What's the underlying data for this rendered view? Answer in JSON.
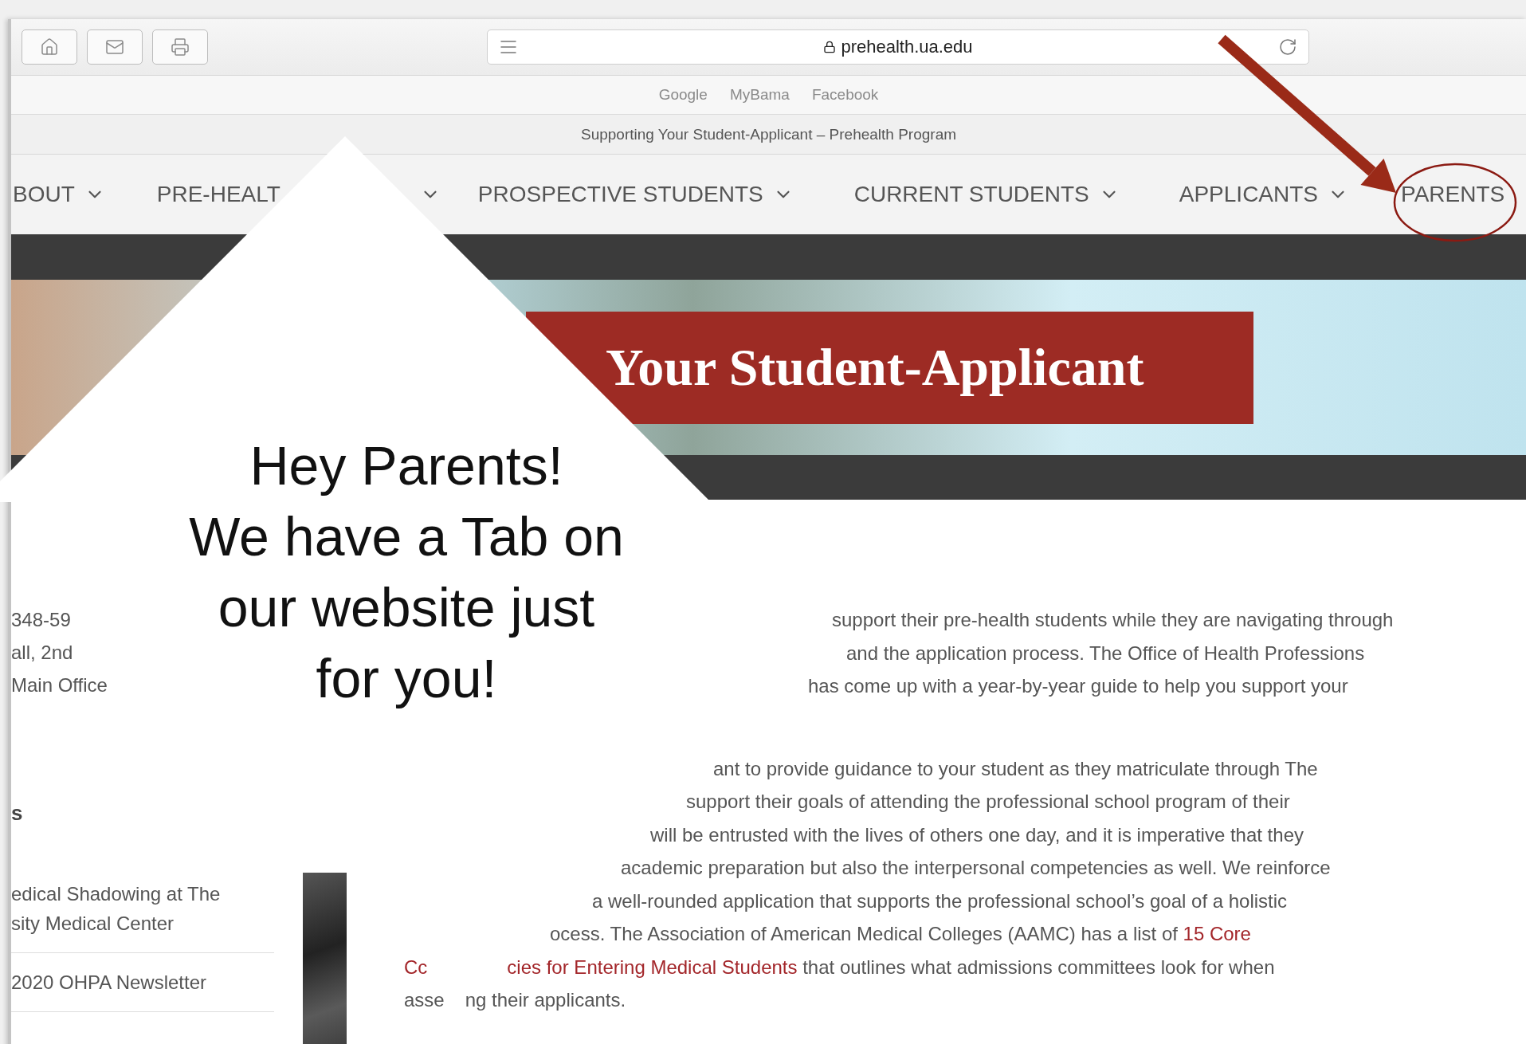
{
  "browser": {
    "buttons": [
      {
        "kind": "home"
      },
      {
        "kind": "mail"
      },
      {
        "kind": "print"
      }
    ],
    "address": "prehealth.ua.edu"
  },
  "bookmarks": [
    "Google",
    "MyBama",
    "Facebook"
  ],
  "page_title": "Supporting Your Student-Applicant – Prehealth Program",
  "nav": [
    {
      "label": "BOUT",
      "dropdown": true
    },
    {
      "label": "PRE-HEALT",
      "dropdown": true
    },
    {
      "label": "PROSPECTIVE STUDENTS",
      "dropdown": true
    },
    {
      "label": "CURRENT STUDENTS",
      "dropdown": true
    },
    {
      "label": "APPLICANTS",
      "dropdown": true
    },
    {
      "label": "PARENTS",
      "dropdown": false
    }
  ],
  "banner": {
    "title": "Your Student-Applicant"
  },
  "sidebar": {
    "contact": [
      "348-59",
      "all, 2nd",
      "Main Office"
    ],
    "heading": "s",
    "links": [
      {
        "lines": [
          "edical Shadowing at The",
          "sity Medical Center"
        ]
      },
      {
        "lines": [
          "2020 OHPA Newsletter"
        ]
      }
    ]
  },
  "body": [
    {
      "lines": [
        {
          "pieces": [
            {
              "runs": [
                {
                  "text": "support their pre-health students while they are navigating through",
                  "link": false
                }
              ]
            }
          ]
        },
        {
          "pieces": [
            {
              "runs": [
                {
                  "text": "and the application process. The Office of Health Professions",
                  "link": false
                }
              ]
            }
          ]
        },
        {
          "pieces": [
            {
              "runs": [
                {
                  "text": "has come up with a year-by-year guide to help you support your",
                  "link": false
                }
              ]
            }
          ]
        }
      ]
    },
    {
      "lines": [
        {
          "pieces": [
            {
              "runs": [
                {
                  "text": "ant to provide guidance to your student as they matriculate through The",
                  "link": false
                }
              ]
            }
          ]
        },
        {
          "pieces": [
            {
              "runs": [
                {
                  "text": "support their goals of attending the professional school program of their",
                  "link": false
                }
              ]
            }
          ]
        },
        {
          "pieces": [
            {
              "runs": [
                {
                  "text": "will be entrusted with the lives of others one day, and it is imperative that they",
                  "link": false
                }
              ]
            }
          ]
        },
        {
          "pieces": [
            {
              "runs": [
                {
                  "text": "academic preparation but also the interpersonal competencies as well. We reinforce",
                  "link": false
                }
              ]
            }
          ]
        },
        {
          "pieces": [
            {
              "runs": [
                {
                  "text": "a well-rounded application that supports the professional school’s goal of a holistic",
                  "link": false
                }
              ]
            }
          ]
        },
        {
          "pieces": [
            {
              "runs": [
                {
                  "text": "ocess. The Association of American Medical Colleges (AAMC) has a list of ",
                  "link": false
                },
                {
                  "text": "15 Core",
                  "link": true
                }
              ]
            }
          ]
        },
        {
          "pieces": [
            {
              "runs": [
                {
                  "text": "Cc",
                  "link": true
                }
              ]
            },
            {
              "runs": [
                {
                  "text": "cies for Entering Medical Students",
                  "link": true
                },
                {
                  "text": " that outlines what admissions committees look for when",
                  "link": false
                }
              ]
            }
          ]
        },
        {
          "pieces": [
            {
              "runs": [
                {
                  "text": "asse",
                  "link": false
                }
              ]
            },
            {
              "runs": [
                {
                  "text": "ng their applicants.",
                  "link": false
                }
              ]
            }
          ]
        }
      ]
    }
  ],
  "callout": {
    "lines": [
      "Hey Parents!",
      "We have a Tab on",
      "our website just",
      "for you!"
    ]
  }
}
